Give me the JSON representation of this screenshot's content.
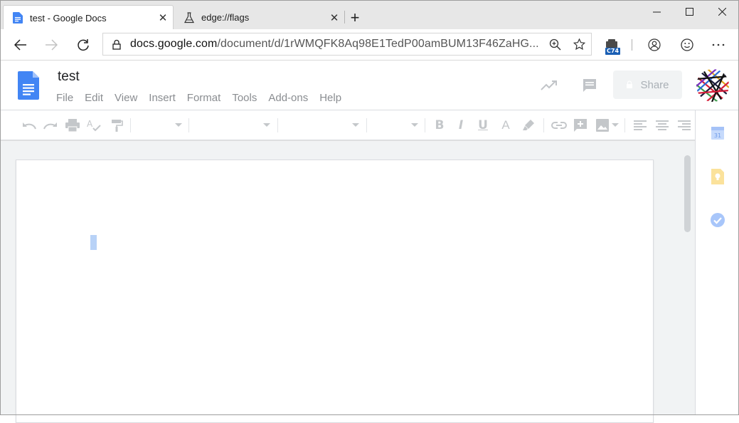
{
  "browser": {
    "tabs": [
      {
        "title": "test - Google Docs",
        "icon": "google-docs-icon",
        "active": true
      },
      {
        "title": "edge://flags",
        "icon": "flask-icon",
        "active": false
      }
    ],
    "new_tab_symbol": "+",
    "window_controls": {
      "minimize": "minimize-icon",
      "maximize": "maximize-icon",
      "close": "close-icon"
    },
    "url_domain": "docs.google.com",
    "url_path": "/document/d/1rWMQFK8Aq98E1TedP00amBUM13F46ZaHG...",
    "extension_badge": "C74",
    "accent_color": "#1a73e8"
  },
  "docs": {
    "title": "test",
    "menu": [
      "File",
      "Edit",
      "View",
      "Insert",
      "Format",
      "Tools",
      "Add-ons",
      "Help"
    ],
    "share_label": "Share",
    "calendar_day": "31",
    "toolbar_icons": [
      "undo-icon",
      "redo-icon",
      "print-icon",
      "spellcheck-icon",
      "paint-format-icon",
      "zoom-dropdown",
      "style-dropdown",
      "font-dropdown",
      "font-size-dropdown",
      "bold-icon",
      "italic-icon",
      "underline-icon",
      "text-color-icon",
      "highlight-icon",
      "link-icon",
      "comment-icon",
      "image-icon",
      "align-left-icon",
      "align-center-icon",
      "align-right-icon"
    ],
    "toolbar_letters": {
      "bold": "B",
      "italic": "I",
      "underline": "U",
      "text_color": "A"
    }
  }
}
